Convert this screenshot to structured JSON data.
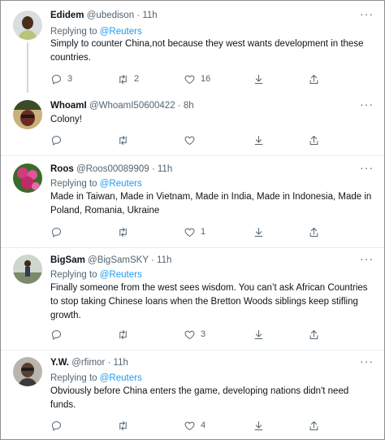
{
  "reply_prefix": "Replying to",
  "tweets": [
    {
      "name": "Edidem",
      "handle": "@ubedison",
      "time": "11h",
      "reply_to": "@Reuters",
      "text": "Simply to counter China,not because they west wants development in these countries.",
      "counts": {
        "reply": "3",
        "retweet": "2",
        "like": "16"
      }
    },
    {
      "name": "WhoamI",
      "handle": "@WhoamI50600422",
      "time": "8h",
      "reply_to": "",
      "text": "Colony!",
      "counts": {
        "reply": "",
        "retweet": "",
        "like": ""
      }
    },
    {
      "name": "Roos",
      "handle": "@Roos00089909",
      "time": "11h",
      "reply_to": "@Reuters",
      "text": "Made in Taiwan, Made in Vietnam, Made in India, Made in Indonesia, Made in Poland, Romania, Ukraine",
      "counts": {
        "reply": "",
        "retweet": "",
        "like": "1"
      }
    },
    {
      "name": "BigSam",
      "handle": "@BigSamSKY",
      "time": "11h",
      "reply_to": "@Reuters",
      "text": "Finally someone from the west sees wisdom. You can’t ask African Countries to stop taking Chinese loans when the Bretton Woods siblings keep stifling growth.",
      "counts": {
        "reply": "",
        "retweet": "",
        "like": "3"
      }
    },
    {
      "name": "Y.W.",
      "handle": "@rfimor",
      "time": "11h",
      "reply_to": "@Reuters",
      "text": "Obviously before China enters the game, developing nations didn't need funds.",
      "counts": {
        "reply": "",
        "retweet": "",
        "like": "4"
      }
    }
  ],
  "icons": {
    "reply": "reply-icon",
    "retweet": "retweet-icon",
    "like": "like-icon",
    "save": "save-icon",
    "share": "share-icon",
    "more": "more-icon"
  },
  "colors": {
    "link": "#1d9bf0",
    "muted": "#536471",
    "text": "#0f1419",
    "divider": "#e6ecf0"
  }
}
